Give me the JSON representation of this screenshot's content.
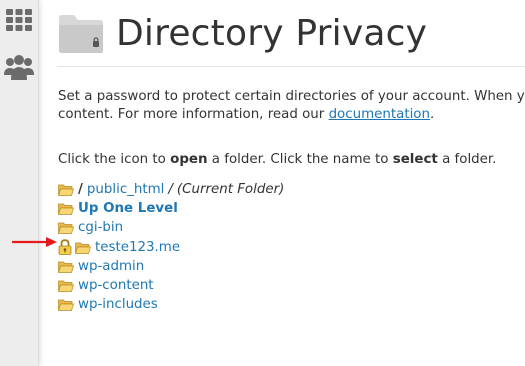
{
  "page": {
    "title": "Directory Privacy"
  },
  "sidebar": {
    "items": [
      {
        "icon": "apps-grid-icon"
      },
      {
        "icon": "users-icon"
      }
    ]
  },
  "intro": {
    "text_before": "Set a password to protect certain directories of your account. When you",
    "text_line2": "content. For more information, read our ",
    "link_label": "documentation",
    "text_after": "."
  },
  "hint": {
    "t1": "Click the icon to ",
    "open": "open",
    "t2": " a folder. Click the name to ",
    "select": "select",
    "t3": " a folder."
  },
  "path": {
    "root_slash": "/",
    "public_html": "public_html",
    "slash": "/",
    "current_label": "(Current Folder)"
  },
  "folders": {
    "up_one_level": "Up One Level",
    "cgi_bin": "cgi-bin",
    "teste123": "teste123.me",
    "wp_admin": "wp-admin",
    "wp_content": "wp-content",
    "wp_includes": "wp-includes"
  },
  "colors": {
    "link": "#1f77b4",
    "text": "#333333",
    "arrow": "#e31b1b",
    "folder": "#f2c94c"
  }
}
